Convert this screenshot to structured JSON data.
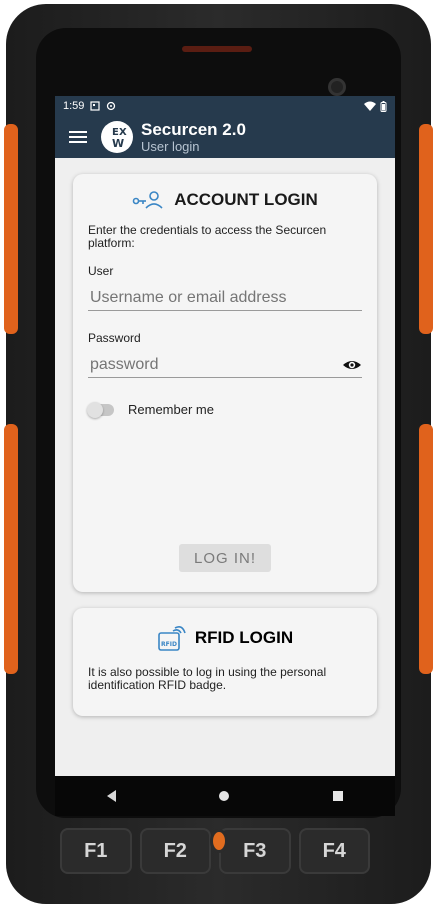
{
  "status_bar": {
    "time": "1:59",
    "left_icons": [
      "notification-icon",
      "sync-icon"
    ],
    "right_icons": [
      "wifi-icon",
      "battery-icon"
    ]
  },
  "app_bar": {
    "title": "Securcen 2.0",
    "subtitle": "User login",
    "menu_icon": "menu-icon",
    "logo_text": "EXW"
  },
  "account_login": {
    "title": "ACCOUNT LOGIN",
    "description": "Enter the credentials to access the Securcen platform:",
    "user_label": "User",
    "user_placeholder": "Username or email address",
    "password_label": "Password",
    "password_placeholder": "password",
    "remember_label": "Remember me",
    "button_label": "LOG IN!"
  },
  "rfid_login": {
    "title": "RFID LOGIN",
    "icon_text": "RFID",
    "description": "It is also possible to log in using the personal identification RFID badge."
  },
  "device_keys": [
    "F1",
    "F2",
    "F3",
    "F4"
  ],
  "colors": {
    "app_bar": "#263a4d",
    "accent": "#3a86c5",
    "device_orange": "#e0621c"
  }
}
